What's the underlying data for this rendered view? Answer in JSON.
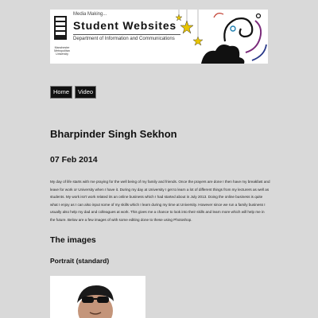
{
  "banner": {
    "kicker": "Media Making...",
    "title": "Student Websites",
    "subtitle": "Department of Information and Communications",
    "logo_text": "Manchester Metropolitan University"
  },
  "nav": {
    "items": [
      {
        "label": "Home"
      },
      {
        "label": "Video"
      }
    ]
  },
  "post": {
    "author": "Bharpinder Singh Sekhon",
    "date": "07 Feb 2014",
    "body": "My day of life starts with me praying for the well being of my family and friends. Once the prayers are done I then have my breakfast and leave for work or University when I have it. During my day at University I get to learn a lot of different things from my lecturers as well as students. My work isn't work related its an online business which I had started about in July 2013. Doing the online business is quite what I enjoy as I can also input some of my skills which I learn during my time at University. However since we run a family business I usually also help my dad and colleagues at work. This gives me a chance to look into their skills and learn more which will help me in the future. Below are a few images of with some editing done to these using Photoshop.",
    "images_heading": "The images",
    "portrait_heading": "Portrait (standard)"
  },
  "icons": {
    "banner_decoration": "stars-and-swirls-icon",
    "logo": "university-crest-icon"
  }
}
